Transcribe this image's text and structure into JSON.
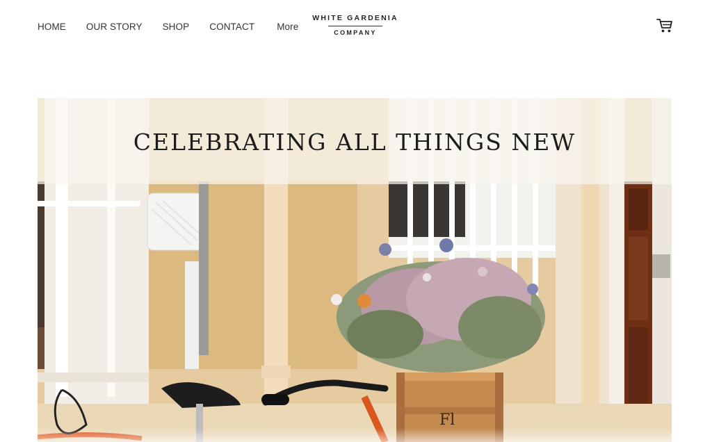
{
  "nav": {
    "items": [
      {
        "label": "HOME"
      },
      {
        "label": "OUR STORY"
      },
      {
        "label": "SHOP"
      },
      {
        "label": "CONTACT"
      },
      {
        "label": "More"
      }
    ]
  },
  "logo": {
    "line1": "WHITE GARDENIA",
    "line2": "COMPANY"
  },
  "cart": {
    "icon": "cart-icon"
  },
  "hero": {
    "banner_text": "CELEBRATING ALL THINGS NEW",
    "image_description_icon": "bicycle-flower-crate-photo"
  }
}
